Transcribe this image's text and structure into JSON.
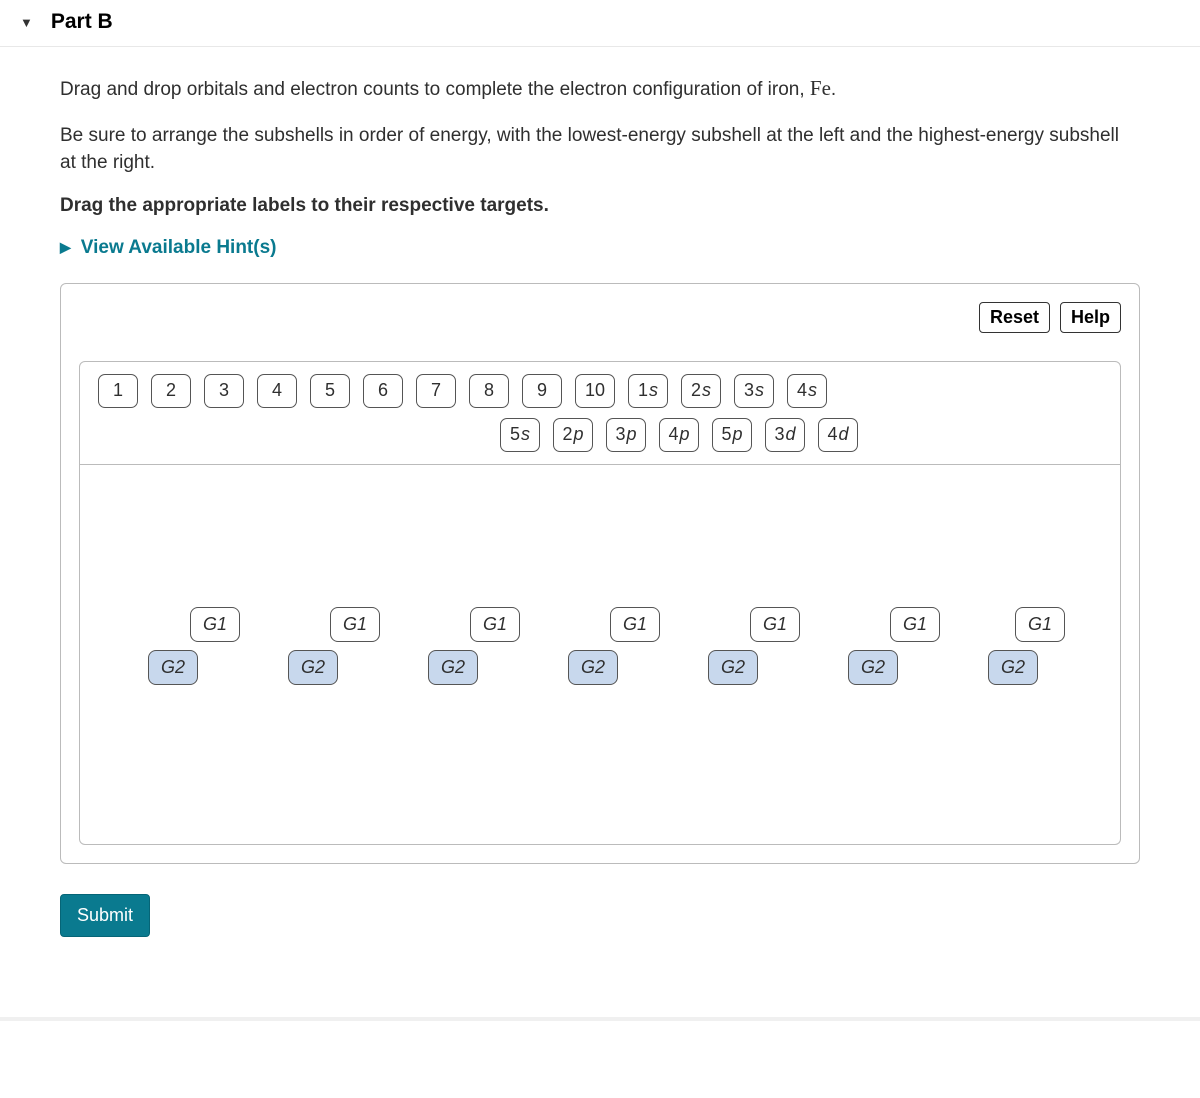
{
  "part": {
    "label": "Part B"
  },
  "instructions": {
    "line1_pre": "Drag and drop orbitals and electron counts to complete the electron configuration of iron, ",
    "element": "Fe",
    "line1_post": ".",
    "line2": "Be sure to arrange the subshells in order of energy, with the lowest-energy subshell at the left and the highest-energy subshell at the right.",
    "bold": "Drag the appropriate labels to their respective targets."
  },
  "hints": {
    "label": "View Available Hint(s)"
  },
  "toolbar": {
    "reset": "Reset",
    "help": "Help"
  },
  "palette": {
    "row1": [
      "1",
      "2",
      "3",
      "4",
      "5",
      "6",
      "7",
      "8",
      "9",
      "10",
      "1s",
      "2s",
      "3s",
      "4s"
    ],
    "row2": [
      "5s",
      "2p",
      "3p",
      "4p",
      "5p",
      "3d",
      "4d"
    ]
  },
  "targets": {
    "g1_label": "G1",
    "g2_label": "G2",
    "pair_count": 7
  },
  "submit": {
    "label": "Submit"
  }
}
